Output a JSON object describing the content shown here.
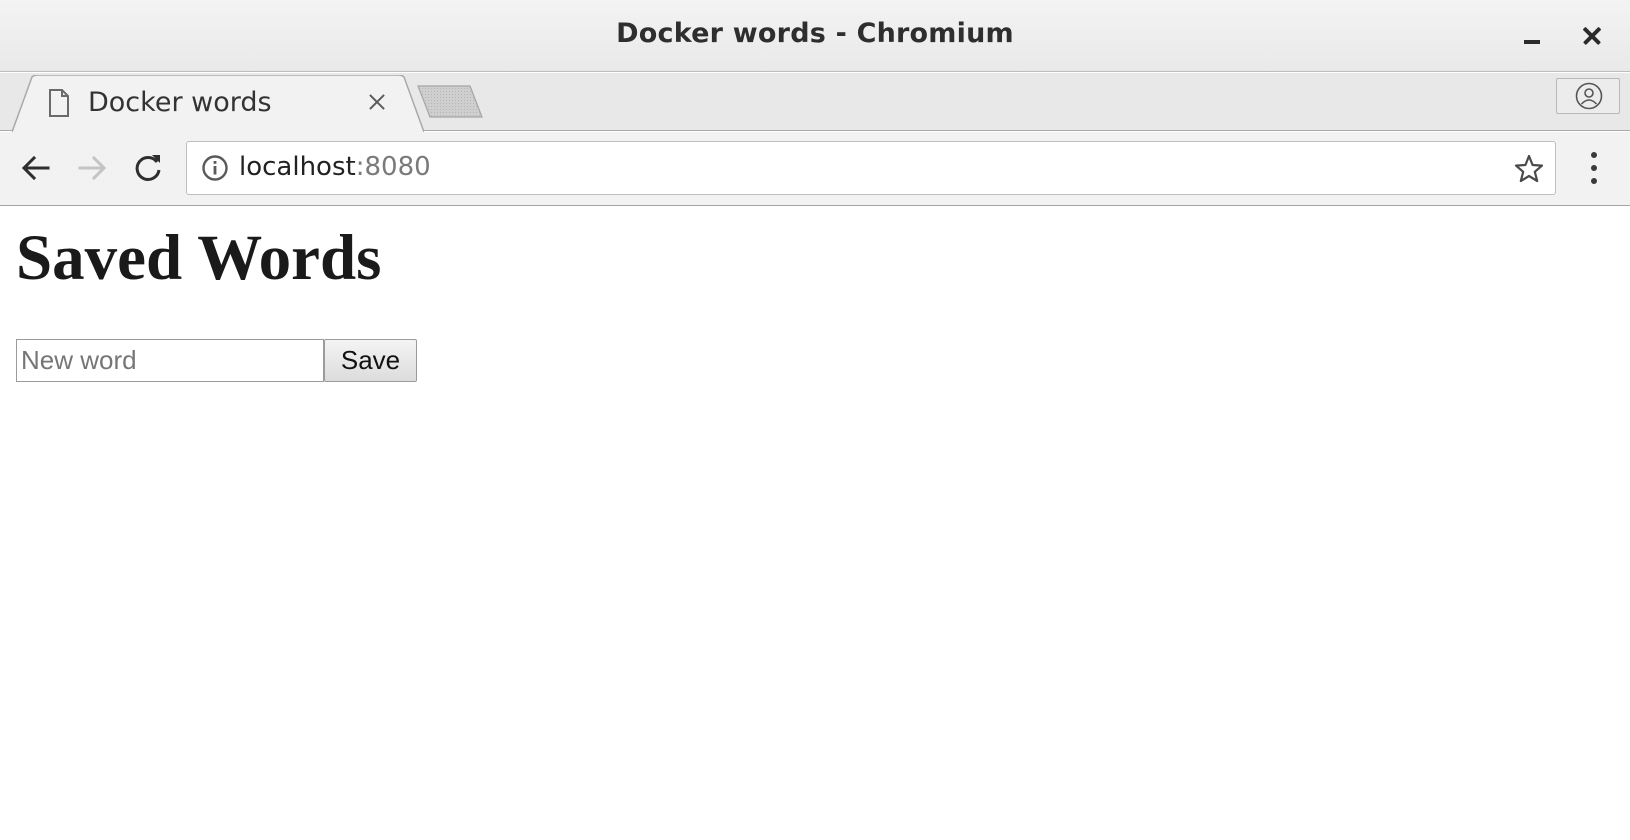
{
  "window": {
    "title": "Docker words - Chromium"
  },
  "tabs": [
    {
      "title": "Docker words",
      "active": true
    }
  ],
  "icons": {
    "favicon": "page-icon",
    "tab_close": "close-icon",
    "new_tab": "new-tab-icon",
    "profile": "person-icon",
    "back": "arrow-left-icon",
    "forward": "arrow-right-icon",
    "reload": "reload-icon",
    "site_info": "info-icon",
    "bookmark": "star-icon",
    "menu": "vertical-dots-icon",
    "minimize": "minimize-icon",
    "close": "close-icon"
  },
  "omnibox": {
    "host": "localhost",
    "port": ":8080"
  },
  "toolbar": {
    "forward_enabled": false
  },
  "page": {
    "heading": "Saved Words",
    "input_placeholder": "New word",
    "input_value": "",
    "save_label": "Save"
  },
  "colors": {
    "title_bar": "#eeeeee",
    "tab_strip": "#e8e8e8",
    "active_tab": "#f2f2f2",
    "toolbar": "#f2f2f2",
    "page_background": "#ffffff",
    "disabled_icon": "#c4c4c4"
  }
}
